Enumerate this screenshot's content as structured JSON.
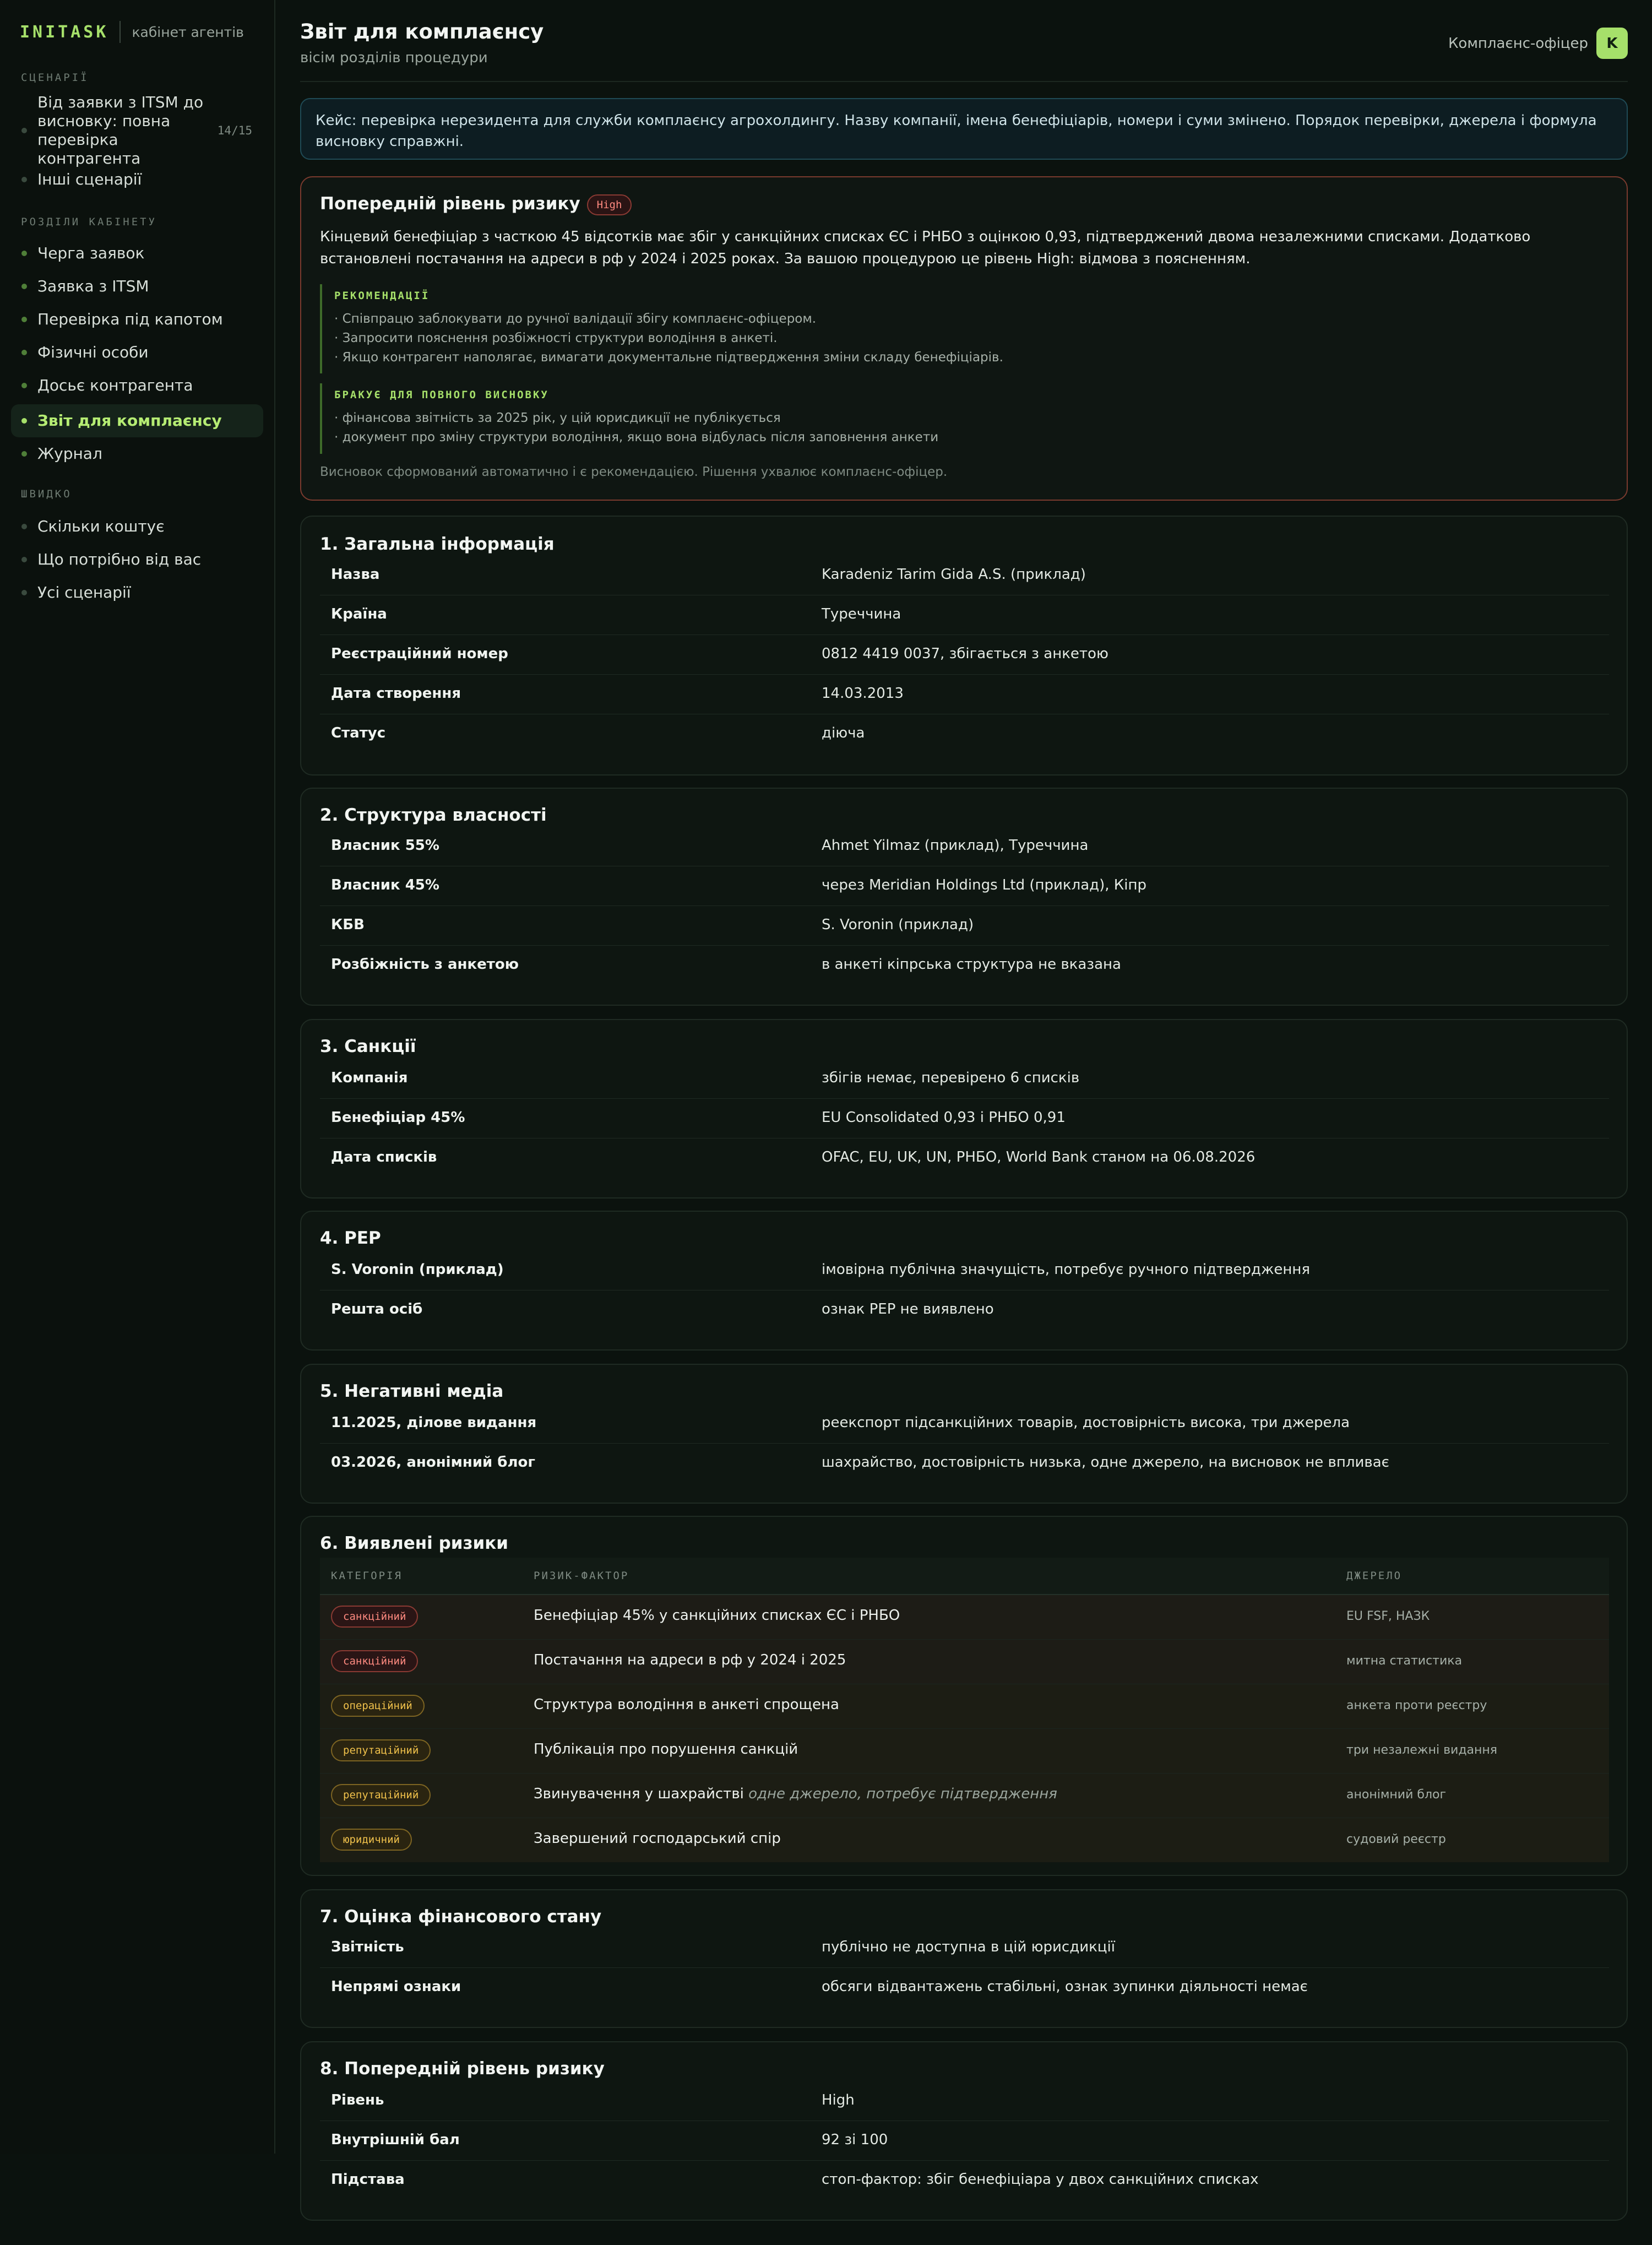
{
  "brand": {
    "logo": "INITASK",
    "subtitle": "кабінет агентів"
  },
  "sidebar": {
    "sections": [
      "СЦЕНАРІЇ",
      "РОЗДІЛИ КАБІНЕТУ",
      "ШВИДКО"
    ],
    "scenarios": [
      {
        "label": "Від заявки з ITSM до висновку: повна перевірка контрагента",
        "count": "14/15"
      },
      {
        "label": "Інші сценарії"
      }
    ],
    "cabinet": [
      {
        "label": "Черга заявок"
      },
      {
        "label": "Заявка з ITSM"
      },
      {
        "label": "Перевірка під капотом"
      },
      {
        "label": "Фізичні особи"
      },
      {
        "label": "Досьє контрагента"
      },
      {
        "label": "Звіт для комплаєнсу",
        "active": true
      },
      {
        "label": "Журнал"
      }
    ],
    "quick": [
      {
        "label": "Скільки коштує"
      },
      {
        "label": "Що потрібно від вас"
      },
      {
        "label": "Усі сценарії"
      }
    ]
  },
  "header": {
    "title": "Звіт для комплаєнсу",
    "subtitle": "вісім розділів процедури",
    "role": "Комплаєнс-офіцер",
    "avatar": "K"
  },
  "notice": "Кейс: перевірка нерезидента для служби комплаєнсу агрохолдингу. Назву компанії, імена бенефіціарів, номери і суми змінено. Порядок перевірки, джерела і формула висновку справжні.",
  "risk_card": {
    "title": "Попередній рівень ризику",
    "badge": "High",
    "text": "Кінцевий бенефіціар з часткою 45 відсотків має збіг у санкційних списках ЄС і РНБО з оцінкою 0,93, підтверджений двома незалежними списками. Додатково встановлені постачання на адреси в рф у 2024 і 2025 роках. За вашою процедурою це рівень High: відмова з поясненням.",
    "recommendations_title": "РЕКОМЕНДАЦІЇ",
    "recommendations": [
      "· Співпрацю заблокувати до ручної валідації збігу комплаєнс-офіцером.",
      "· Запросити пояснення розбіжності структури володіння в анкеті.",
      "· Якщо контрагент наполягає, вимагати документальне підтвердження зміни складу бенефіціарів."
    ],
    "missing_title": "БРАКУЄ ДЛЯ ПОВНОГО ВИСНОВКУ",
    "missing": [
      "· фінансова звітність за 2025 рік, у цій юрисдикції не публікується",
      "· документ про зміну структури володіння, якщо вона відбулась після заповнення анкети"
    ],
    "footer": "Висновок сформований автоматично і є рекомендацією. Рішення ухвалює комплаєнс-офіцер."
  },
  "sections": {
    "general": {
      "title": "1. Загальна інформація",
      "rows": [
        {
          "k": "Назва",
          "v": "Karadeniz Tarim Gida A.S. (приклад)"
        },
        {
          "k": "Країна",
          "v": "Туреччина"
        },
        {
          "k": "Реєстраційний номер",
          "v": "0812 4419 0037, збігається з анкетою"
        },
        {
          "k": "Дата створення",
          "v": "14.03.2013"
        },
        {
          "k": "Статус",
          "v": "діюча"
        }
      ]
    },
    "ownership": {
      "title": "2. Структура власності",
      "rows": [
        {
          "k": "Власник 55%",
          "v": "Ahmet Yilmaz (приклад), Туреччина"
        },
        {
          "k": "Власник 45%",
          "v": "через Meridian Holdings Ltd (приклад), Кіпр"
        },
        {
          "k": "КБВ",
          "v": "S. Voronin (приклад)"
        },
        {
          "k": "Розбіжність з анкетою",
          "v": "в анкеті кіпрська структура не вказана"
        }
      ]
    },
    "sanctions": {
      "title": "3. Санкції",
      "rows": [
        {
          "k": "Компанія",
          "v": "збігів немає, перевірено 6 списків"
        },
        {
          "k": "Бенефіціар 45%",
          "v": "EU Consolidated 0,93 і РНБО 0,91"
        },
        {
          "k": "Дата списків",
          "v": "OFAC, EU, UK, UN, РНБО, World Bank станом на 06.08.2026"
        }
      ]
    },
    "pep": {
      "title": "4. PEP",
      "rows": [
        {
          "k": "S. Voronin (приклад)",
          "v": "імовірна публічна значущість, потребує ручного підтвердження"
        },
        {
          "k": "Решта осіб",
          "v": "ознак PEP не виявлено"
        }
      ]
    },
    "media": {
      "title": "5. Негативні медіа",
      "rows": [
        {
          "k": "11.2025, ділове видання",
          "v": "реекспорт підсанкційних товарів, достовірність висока, три джерела"
        },
        {
          "k": "03.2026, анонімний блог",
          "v": "шахрайство, достовірність низька, одне джерело, на висновок не впливає"
        }
      ]
    },
    "risks": {
      "title": "6. Виявлені ризики",
      "columns": [
        "КАТЕГОРІЯ",
        "РИЗИК-ФАКТОР",
        "ДЖЕРЕЛО"
      ],
      "rows": [
        {
          "cat": "санкційний",
          "tone": "red",
          "factor": "Бенефіціар 45% у санкційних списках ЄС і РНБО",
          "note": "",
          "source": "EU FSF, НАЗК"
        },
        {
          "cat": "санкційний",
          "tone": "red",
          "factor": "Постачання на адреси в рф у 2024 і 2025",
          "note": "",
          "source": "митна статистика"
        },
        {
          "cat": "операційний",
          "tone": "yel",
          "factor": "Структура володіння в анкеті спрощена",
          "note": "",
          "source": "анкета проти реєстру"
        },
        {
          "cat": "репутаційний",
          "tone": "yel",
          "factor": "Публікація про порушення санкцій",
          "note": "",
          "source": "три незалежні видання"
        },
        {
          "cat": "репутаційний",
          "tone": "yel",
          "factor": "Звинувачення у шахрайстві",
          "note": "одне джерело, потребує підтвердження",
          "source": "анонімний блог"
        },
        {
          "cat": "юридичний",
          "tone": "yel",
          "factor": "Завершений господарський спір",
          "note": "",
          "source": "судовий реєстр"
        }
      ]
    },
    "finance": {
      "title": "7. Оцінка фінансового стану",
      "rows": [
        {
          "k": "Звітність",
          "v": "публічно не доступна в цій юрисдикції"
        },
        {
          "k": "Непрямі ознаки",
          "v": "обсяги відвантажень стабільні, ознак зупинки діяльності немає"
        }
      ]
    },
    "risk_level": {
      "title": "8. Попередній рівень ризику",
      "rows": [
        {
          "k": "Рівень",
          "v": "High"
        },
        {
          "k": "Внутрішній бал",
          "v": "92 зі 100"
        },
        {
          "k": "Підстава",
          "v": "стоп-фактор: збіг бенефіціара у двох санкційних списках"
        }
      ]
    }
  }
}
